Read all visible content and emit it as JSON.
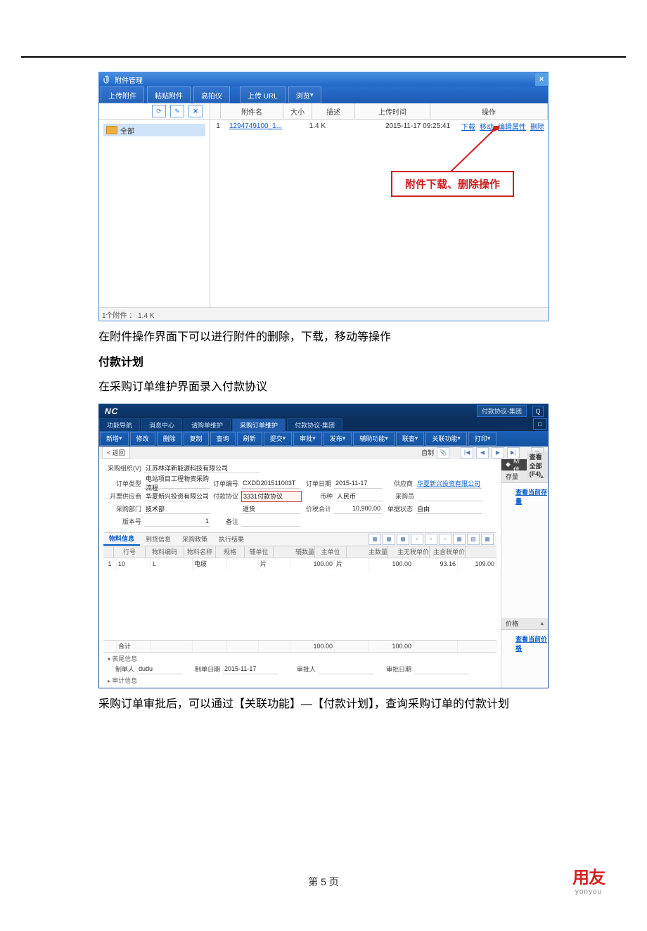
{
  "attach_win": {
    "title": "附件管理",
    "toolbar": {
      "upload": "上传附件",
      "paste": "粘贴附件",
      "pick": "高拍仪",
      "url": "上传 URL",
      "browse": "浏览"
    },
    "folder_all": "全部",
    "columns": {
      "name": "附件名",
      "size": "大小",
      "desc": "描述",
      "time": "上传时间",
      "ops": "操作"
    },
    "row": {
      "idx": "1",
      "name": "1294749100_1...",
      "size": "1.4 K",
      "time": "2015-11-17 09:25:41",
      "ops": {
        "download": "下载",
        "move": "移动",
        "edit": "编辑属性",
        "delete": "删除"
      }
    },
    "status": "1个附件 ：    1.4 K",
    "callout": "附件下载、删除操作"
  },
  "para1": "在附件操作界面下可以进行附件的删除，下载，移动等操作",
  "heading2": "付款计划",
  "para2": "在采购订单维护界面录入付款协议",
  "erp": {
    "top": {
      "logo": "NC",
      "search_ph": "付款协议-集团",
      "q": "Q"
    },
    "nav": {
      "t1": "功能导航",
      "t2": "消息中心",
      "t3": "请购单维护",
      "t4": "采购订单维护",
      "t5": "付款协议-集团"
    },
    "toolbar": {
      "new": "新增",
      "edit": "修改",
      "del": "删除",
      "copy": "复制",
      "query": "查询",
      "refresh": "刷新",
      "submit": "提交",
      "review": "审批",
      "dispatch": "发布",
      "aux": "辅助功能",
      "link": "联查",
      "related": "关联功能",
      "print": "打印"
    },
    "back": {
      "label": "< 返回",
      "self": "自制",
      "aux_info": "辅助信息",
      "view_all": "查看全部 (F4)"
    },
    "side": {
      "h1": "存量",
      "link1": "查看当前存量",
      "h2": "价格",
      "link2": "查看当前价格"
    },
    "form": {
      "r1": {
        "l": "采购组织(V)",
        "v": "江苏林洋新能源科技有限公司"
      },
      "r2": {
        "l1": "订单类型",
        "v1": "电站项目工程物资采购流程",
        "l2": "订单编号",
        "v2": "CXDD201511003T",
        "l3": "订单日期",
        "v3": "2015-11-17",
        "l4": "供应商",
        "v4": "华夏新兴投资有限公司"
      },
      "r3": {
        "l1": "开票供应商",
        "v1": "华夏新兴投资有限公司",
        "l2": "付款协议",
        "v2": "3331付款协议",
        "l3": "币种",
        "v3": "人民币",
        "l4": "采购员",
        "v4": ""
      },
      "r4": {
        "l1": "采购部门",
        "v1": "技术部",
        "l2": "",
        "v2": "退货",
        "l3": "价税合计",
        "v3": "10,900.00",
        "l4": "单据状态",
        "v4": "自由"
      },
      "r5": {
        "l1": "版本号",
        "v1": "1",
        "l2": "备注",
        "v2": ""
      }
    },
    "subtabs": {
      "t1": "物料信息",
      "t2": "到货信息",
      "t3": "采购政策",
      "t4": "执行结果"
    },
    "grid": {
      "cols": {
        "idx": "",
        "line": "行号",
        "code": "物料编码",
        "mname": "物料名称",
        "spec": "规格",
        "au": "辅单位",
        "aq": "辅数量",
        "mu": "主单位",
        "mq": "主数量",
        "mup": "主无税单价",
        "mtp": "主含税单价"
      },
      "row": {
        "idx": "1",
        "line": "10",
        "code": "L",
        "mname": "电缆",
        "spec": "",
        "au": "片",
        "aq": "100.00",
        "mu": "片",
        "mq": "100.00",
        "mup": "93.16",
        "mtp": "109.00"
      },
      "total": {
        "label": "合计",
        "aq": "100.00",
        "mq": "100.00"
      },
      "footer": {
        "h1": "表尾信息",
        "l1": "制单人",
        "v1": "dudu",
        "l2": "制单日期",
        "v2": "2015-11-17",
        "l3": "审批人",
        "v3": "",
        "l4": "审批日期",
        "v4": "",
        "h2": "审计信息"
      }
    }
  },
  "para3": "采购订单审批后，可以通过【关联功能】—【付款计划】，查询采购订单的付款计划",
  "footer": {
    "page": "第 5 页",
    "logo": "用友",
    "sub": "yonyou"
  }
}
